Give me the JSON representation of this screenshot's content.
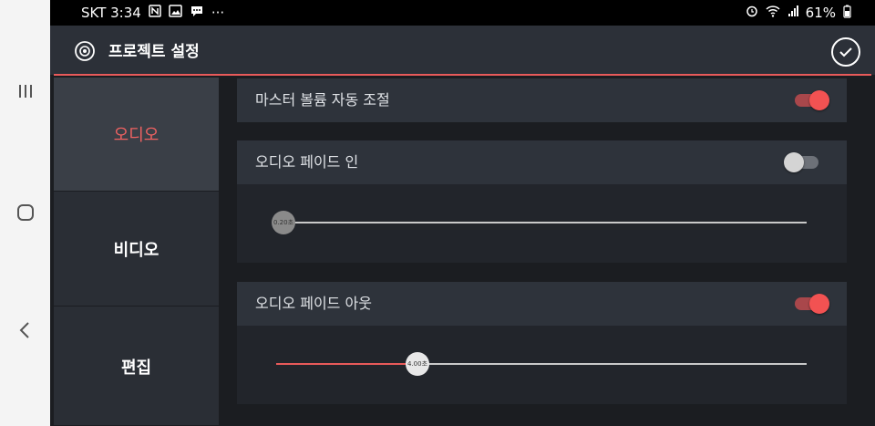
{
  "status_bar": {
    "carrier_time": "SKT 3:34",
    "battery": "61%",
    "more": "···"
  },
  "header": {
    "title": "프로젝트 설정"
  },
  "sidebar": {
    "tabs": [
      {
        "label": "오디오",
        "active": true
      },
      {
        "label": "비디오",
        "active": false
      },
      {
        "label": "편집",
        "active": false
      }
    ]
  },
  "settings": {
    "master_volume": {
      "label": "마스터 볼륨 자동 조절",
      "enabled": true
    },
    "fade_in": {
      "label": "오디오 페이드 인",
      "enabled": false,
      "value_label": "0.20초",
      "fraction": 0.0
    },
    "fade_out": {
      "label": "오디오 페이드 아웃",
      "enabled": true,
      "value_label": "4.00초",
      "fraction": 0.267
    }
  },
  "colors": {
    "accent": "#e85a5a",
    "background": "#1b1d21",
    "header": "#2c3038"
  }
}
